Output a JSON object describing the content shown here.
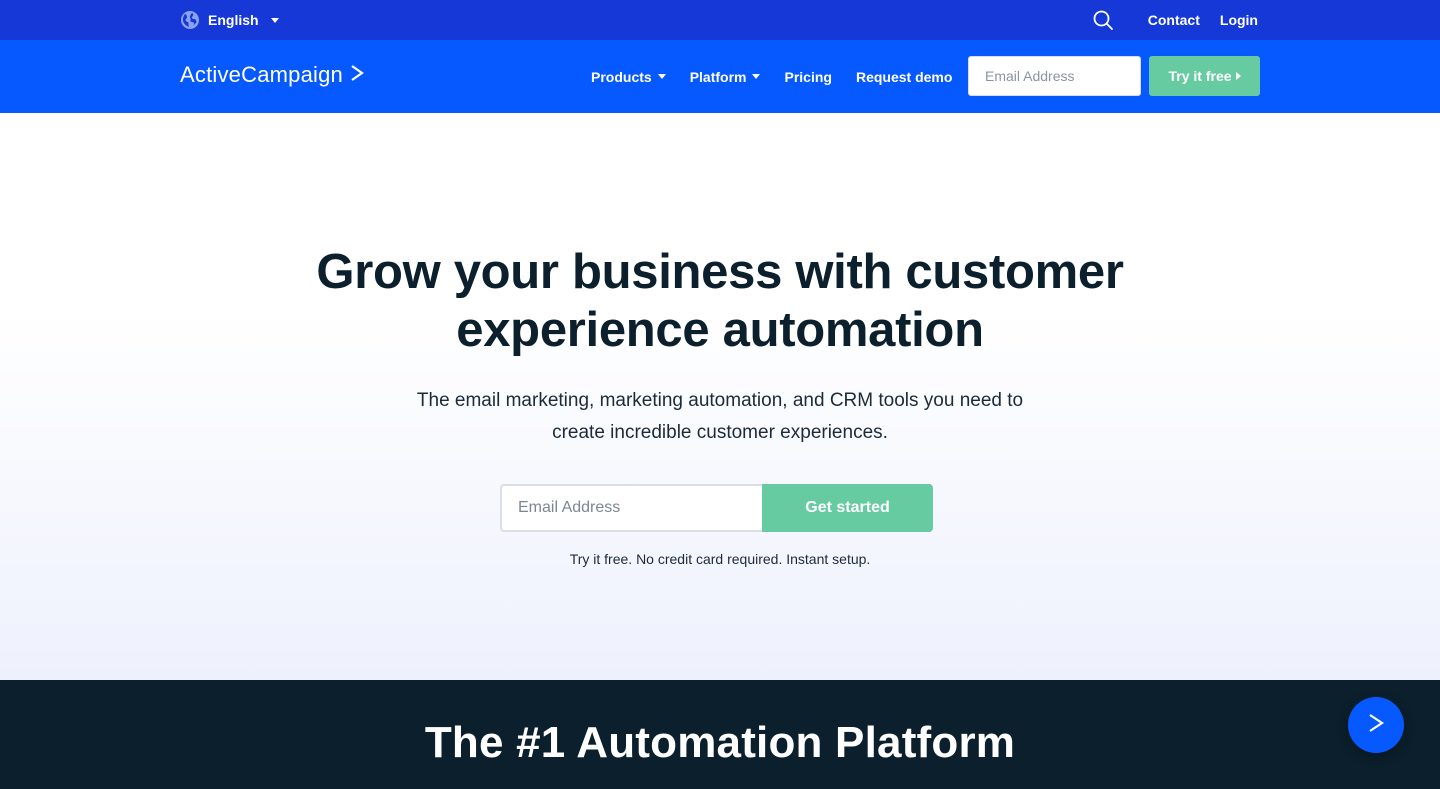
{
  "utility": {
    "language": "English",
    "contact": "Contact",
    "login": "Login"
  },
  "nav": {
    "logo": "ActiveCampaign",
    "items": [
      {
        "label": "Products",
        "dropdown": true
      },
      {
        "label": "Platform",
        "dropdown": true
      },
      {
        "label": "Pricing",
        "dropdown": false
      },
      {
        "label": "Request demo",
        "dropdown": false
      }
    ],
    "email_placeholder": "Email Address",
    "cta": "Try it free"
  },
  "hero": {
    "title_line1": "Grow your business with customer",
    "title_line2": "experience automation",
    "subtitle_line1": "The email marketing, marketing automation, and CRM tools you need to",
    "subtitle_line2": "create incredible customer experiences.",
    "email_placeholder": "Email Address",
    "button": "Get started",
    "note": "Try it free. No credit card required. Instant setup."
  },
  "section": {
    "title": "The #1 Automation Platform"
  },
  "colors": {
    "utility_bar": "#1538d6",
    "nav_bar": "#0559ff",
    "cta_green": "#67cba1",
    "dark": "#0b1f2c"
  }
}
